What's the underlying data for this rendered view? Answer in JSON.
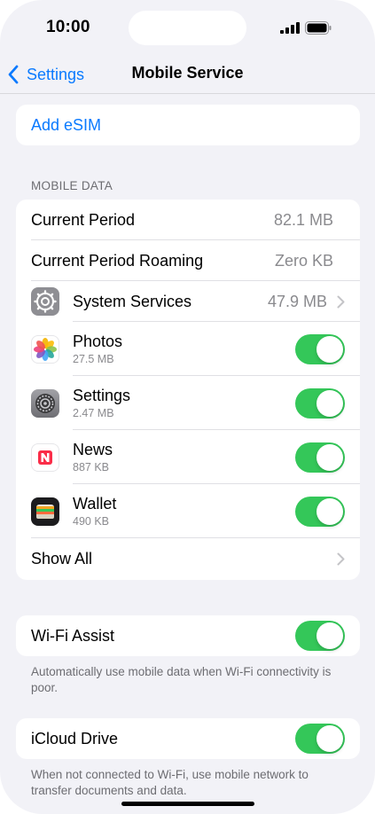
{
  "status_bar": {
    "time": "10:00"
  },
  "nav": {
    "back_label": "Settings",
    "title": "Mobile Service"
  },
  "esim": {
    "label": "Add eSIM"
  },
  "mobile_data": {
    "header": "MOBILE DATA",
    "current_period": {
      "label": "Current Period",
      "value": "82.1 MB"
    },
    "roaming": {
      "label": "Current Period Roaming",
      "value": "Zero KB"
    },
    "system_services": {
      "label": "System Services",
      "value": "47.9 MB",
      "icon": "gear-icon"
    },
    "apps": [
      {
        "name": "Photos",
        "size": "27.5 MB",
        "icon": "photos-icon",
        "enabled": true
      },
      {
        "name": "Settings",
        "size": "2.47 MB",
        "icon": "settings-icon",
        "enabled": true
      },
      {
        "name": "News",
        "size": "887 KB",
        "icon": "news-icon",
        "enabled": true
      },
      {
        "name": "Wallet",
        "size": "490 KB",
        "icon": "wallet-icon",
        "enabled": true
      }
    ],
    "show_all": {
      "label": "Show All"
    }
  },
  "wifi_assist": {
    "label": "Wi-Fi Assist",
    "enabled": true,
    "footnote": "Automatically use mobile data when Wi-Fi connectivity is poor."
  },
  "icloud_drive": {
    "label": "iCloud Drive",
    "enabled": true,
    "footnote": "When not connected to Wi-Fi, use mobile network to transfer documents and data."
  },
  "colors": {
    "accent": "#0a7aff",
    "toggle_on": "#34c759",
    "background": "#f2f2f7",
    "secondary_text": "#8a8a8e"
  }
}
